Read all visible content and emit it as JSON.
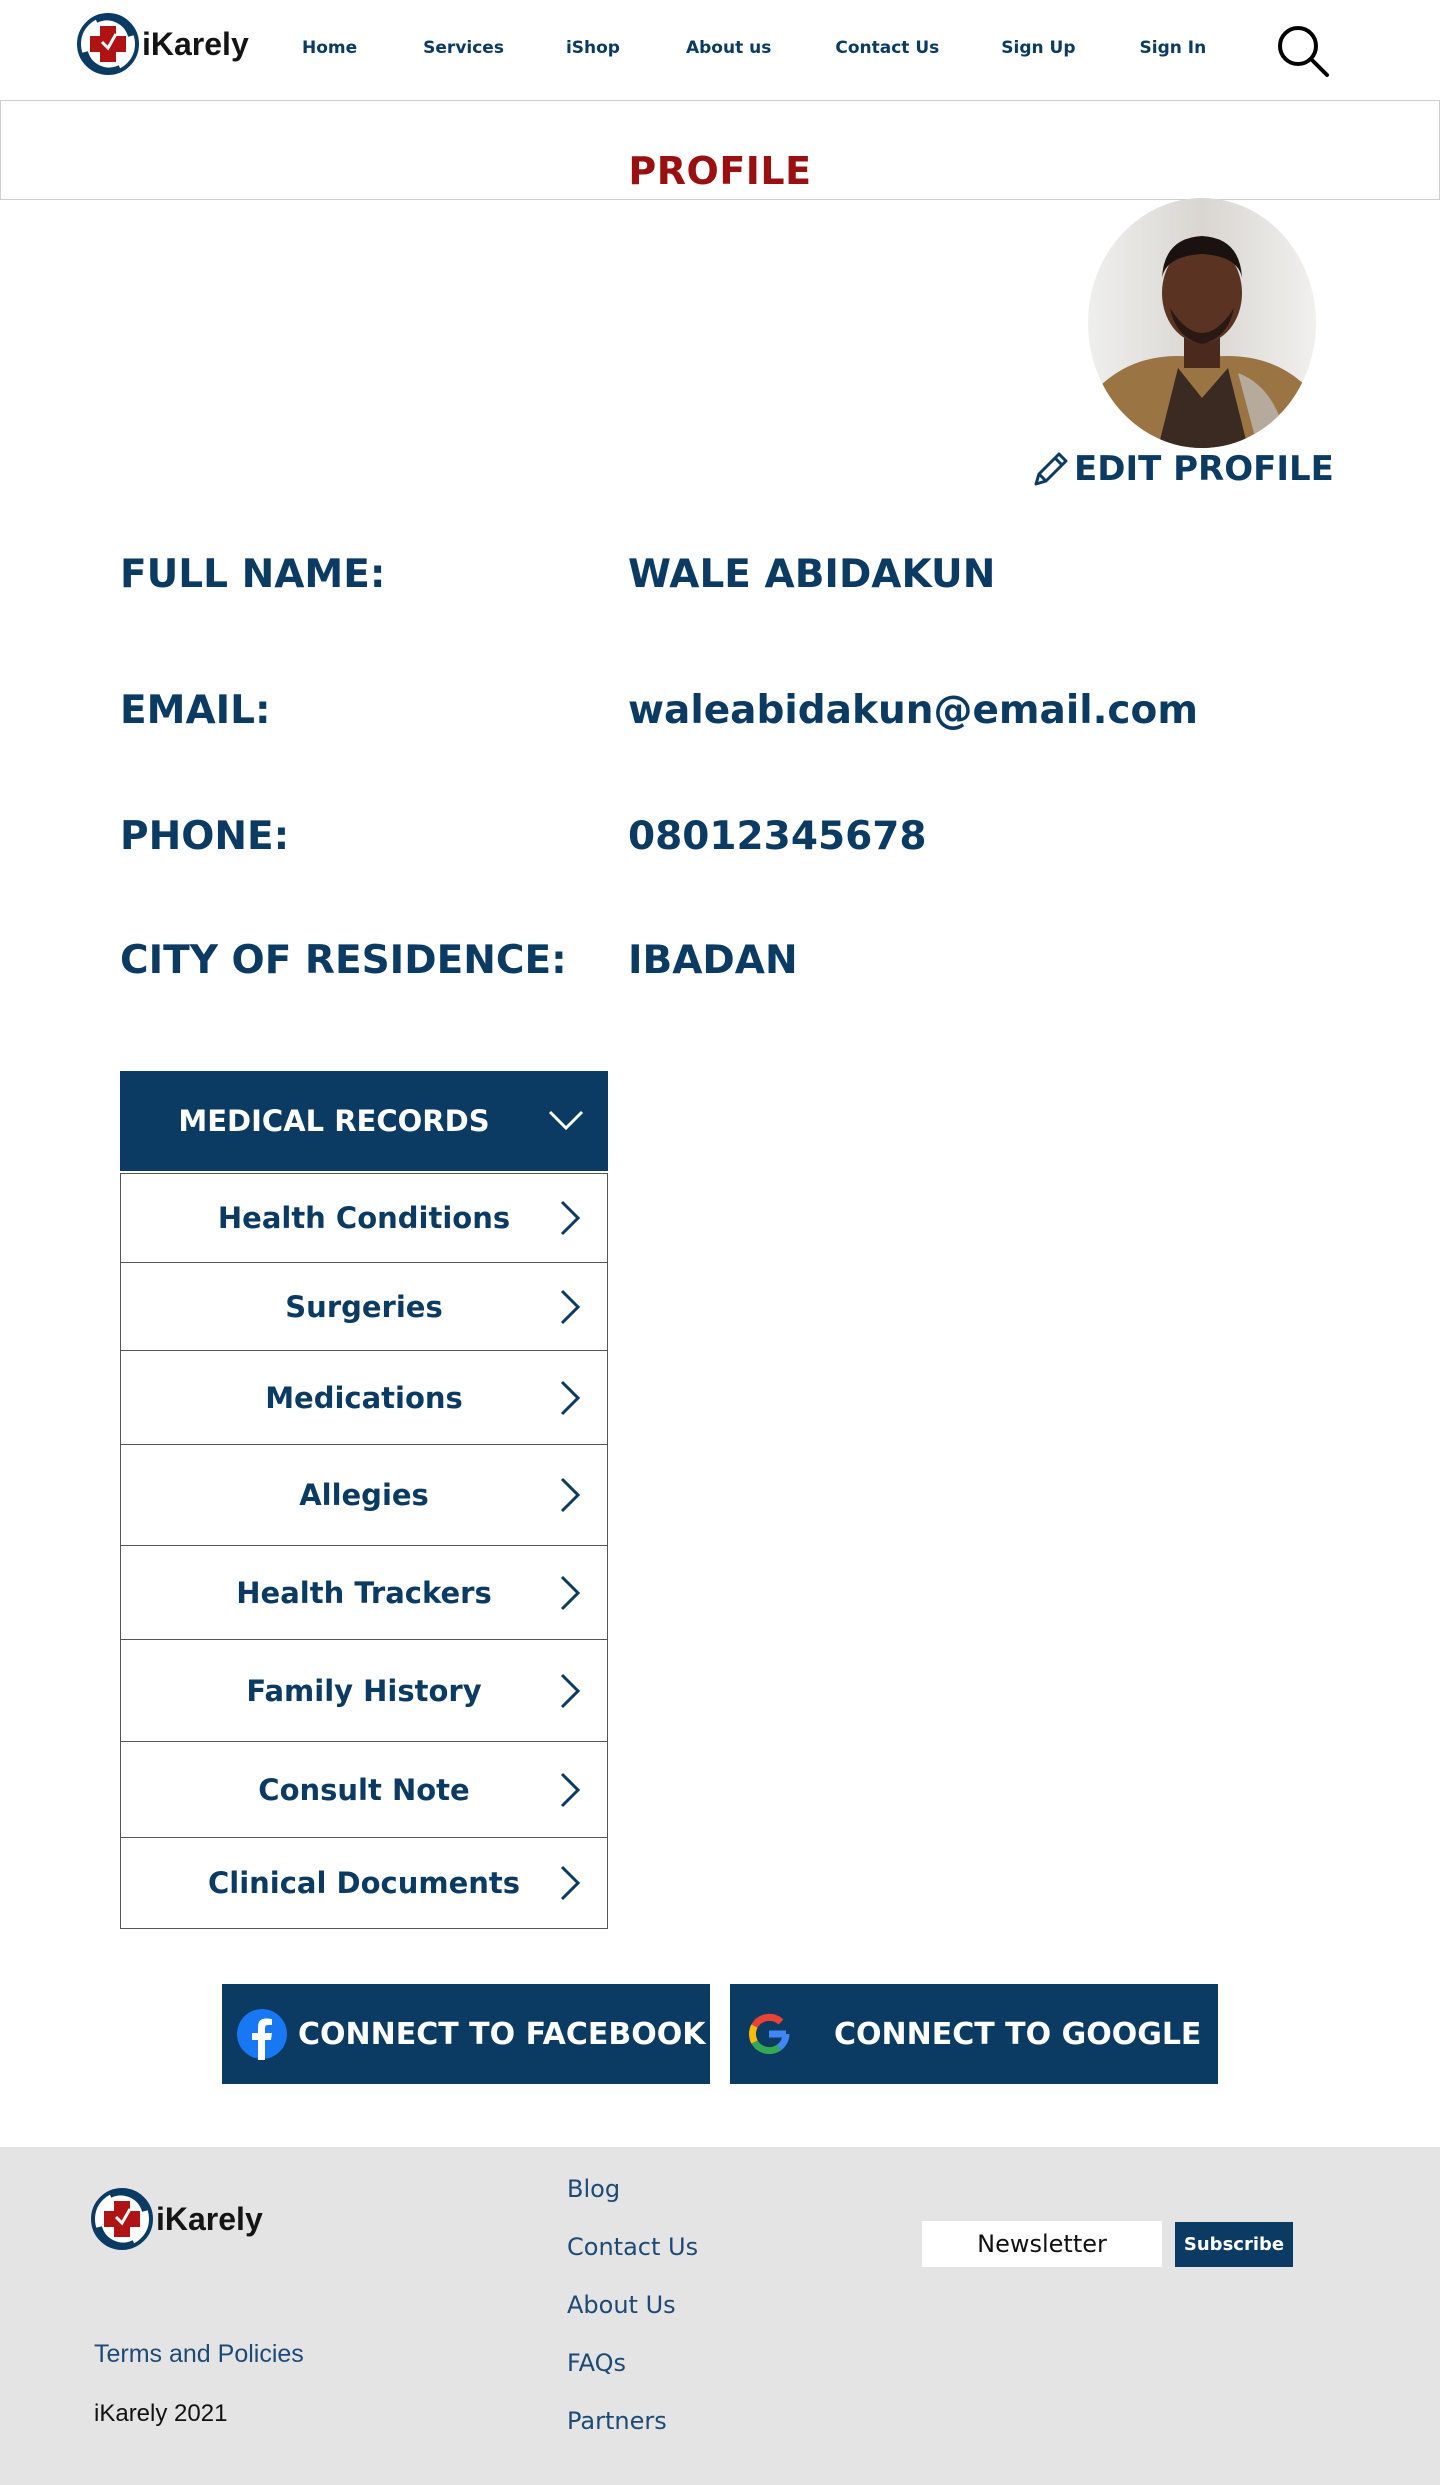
{
  "brand": {
    "name": "iKarely",
    "logo_icon": "medical-cross-logo-icon",
    "primary_color": "#0b3a63",
    "accent_color": "#9a0f0f"
  },
  "nav": {
    "items": [
      {
        "label": "Home"
      },
      {
        "label": "Services"
      },
      {
        "label": "iShop"
      },
      {
        "label": "About us"
      },
      {
        "label": "Contact Us"
      },
      {
        "label": "Sign Up"
      },
      {
        "label": "Sign In"
      }
    ],
    "search_icon": "search-icon"
  },
  "page": {
    "title": "PROFILE"
  },
  "profile": {
    "edit_label": "EDIT PROFILE",
    "edit_icon": "pencil-icon",
    "fields": [
      {
        "label": "FULL NAME:",
        "value": "WALE ABIDAKUN"
      },
      {
        "label": "EMAIL:",
        "value": "waleabidakun@email.com"
      },
      {
        "label": "PHONE:",
        "value": "08012345678"
      },
      {
        "label": "CITY OF RESIDENCE:",
        "value": "IBADAN"
      }
    ]
  },
  "medical_records": {
    "title": "MEDICAL RECORDS",
    "items": [
      {
        "label": "Health Conditions"
      },
      {
        "label": "Surgeries"
      },
      {
        "label": "Medications"
      },
      {
        "label": "Allegies"
      },
      {
        "label": "Health Trackers"
      },
      {
        "label": "Family History"
      },
      {
        "label": "Consult Note"
      },
      {
        "label": "Clinical Documents"
      }
    ]
  },
  "connect": {
    "facebook_label": "CONNECT TO FACEBOOK",
    "facebook_icon": "facebook-icon",
    "google_label": "CONNECT TO GOOGLE",
    "google_icon": "google-icon"
  },
  "footer": {
    "links": [
      {
        "label": "Blog"
      },
      {
        "label": "Contact Us"
      },
      {
        "label": "About Us"
      },
      {
        "label": "FAQs"
      },
      {
        "label": "Partners"
      }
    ],
    "terms": "Terms and Policies",
    "copyright": "iKarely 2021",
    "newsletter_placeholder": "Newsletter",
    "subscribe_label": "Subscribe"
  }
}
